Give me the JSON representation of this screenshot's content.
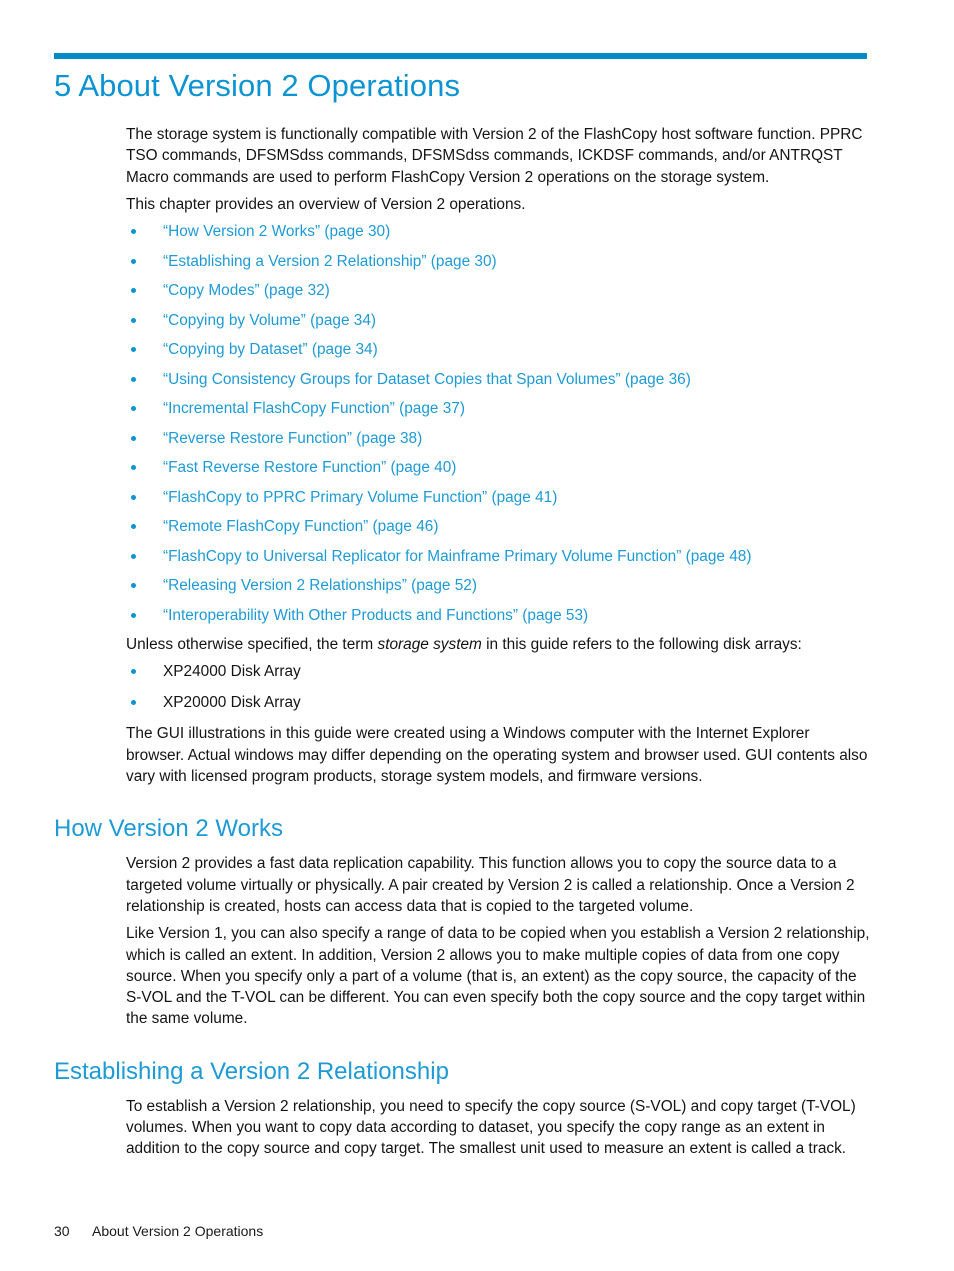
{
  "page": {
    "accent_rule_color": "#0089c4",
    "heading_color": "#1e9ad6",
    "link_color": "#1e9ad6",
    "body_color": "#141414"
  },
  "chapter": {
    "title": "5 About Version 2 Operations",
    "intro_paragraph_1": "The storage system is functionally compatible with Version 2 of the FlashCopy host software function. PPRC TSO commands, DFSMSdss commands, DFSMSdss commands, ICKDSF commands, and/or ANTRQST Macro commands are used to perform FlashCopy Version 2 operations on the storage system.",
    "intro_paragraph_2": "This chapter provides an overview of Version 2 operations."
  },
  "toc_links": [
    "“How Version 2 Works” (page 30)",
    "“Establishing a Version 2 Relationship” (page 30)",
    "“Copy Modes” (page 32)",
    "“Copying by Volume” (page 34)",
    "“Copying by Dataset” (page 34)",
    "“Using Consistency Groups for Dataset Copies that Span Volumes” (page 36)",
    "“Incremental FlashCopy Function” (page 37)",
    "“Reverse Restore Function” (page 38)",
    "“Fast Reverse Restore Function” (page 40)",
    "“FlashCopy to PPRC Primary Volume Function” (page 41)",
    "“Remote FlashCopy Function” (page 46)",
    "“FlashCopy to Universal Replicator for Mainframe Primary Volume Function” (page 48)",
    "“Releasing Version 2 Relationships” (page 52)",
    "“Interoperability With Other Products and Functions” (page 53)"
  ],
  "storage_system_note": {
    "lead_before_term": "Unless otherwise specified, the term ",
    "term": "storage system",
    "lead_after_term": " in this guide refers to the following disk arrays:",
    "disk_arrays": [
      "XP24000 Disk Array",
      "XP20000 Disk Array"
    ],
    "gui_note": "The GUI illustrations in this guide were created using a Windows computer with the Internet Explorer browser. Actual windows may differ depending on the operating system and browser used. GUI contents also vary with licensed program products, storage system models, and firmware versions."
  },
  "sections": [
    {
      "heading": "How Version 2 Works",
      "paragraph_1": "Version 2 provides a fast data replication capability. This function allows you to copy the source data to a targeted volume virtually or physically. A pair created by Version 2 is called a relationship. Once a Version 2 relationship is created, hosts can access data that is copied to the targeted volume.",
      "paragraph_2": "Like Version 1, you can also specify a range of data to be copied when you establish a Version 2 relationship, which is called an extent. In addition, Version 2 allows you to make multiple copies of data from one copy source. When you specify only a part of a volume (that is, an extent) as the copy source, the capacity of the S-VOL and the T-VOL can be different. You can even specify both the copy source and the copy target within the same volume."
    },
    {
      "heading": "Establishing a Version 2 Relationship",
      "paragraph_1": "To establish a Version 2 relationship, you need to specify the copy source (S-VOL) and copy target (T-VOL) volumes. When you want to copy data according to dataset, you specify the copy range as an extent in addition to the copy source and copy target. The smallest unit used to measure an extent is called a track."
    }
  ],
  "footer": {
    "page_number": "30",
    "title": "About Version 2 Operations"
  }
}
